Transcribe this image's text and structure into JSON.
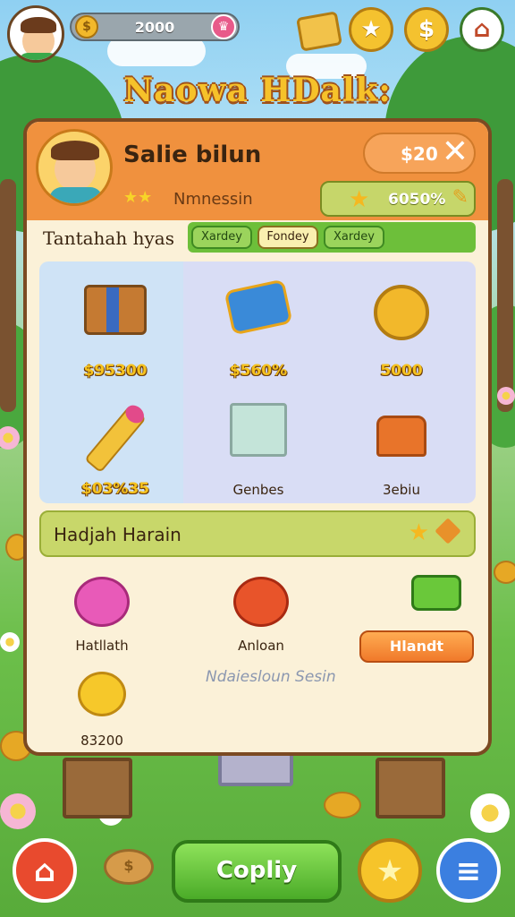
{
  "hud": {
    "coins": "2000",
    "coin_icon": "$",
    "gem_icon": "♛",
    "buttons": [
      "scroll-icon",
      "star-icon",
      "dollar-icon",
      "shop-icon"
    ]
  },
  "game_title": "Naowa HDalk:",
  "panel": {
    "player_name": "Salie bilun",
    "player_rank": "Nmnessin",
    "price": "$20",
    "close": "✕",
    "bonus": "6050%",
    "tabs_title": "Tantahah hyas",
    "tabs": [
      "Xardey",
      "Fondey",
      "Xardey"
    ],
    "grid_items": [
      {
        "label": "$95300",
        "icon": "chest-icon"
      },
      {
        "label": "$560%",
        "icon": "ticket-icon"
      },
      {
        "label": "5000",
        "icon": "gold-coin-icon"
      },
      {
        "label": "$03%35",
        "icon": "wand-icon"
      },
      {
        "label": "Genbes",
        "icon": "crystal-box-icon"
      },
      {
        "label": "3ebiu",
        "icon": "chair-icon"
      }
    ],
    "section_title": "Hadjah Harain",
    "section_items": [
      {
        "label": "Hatllath",
        "icon": "berry-icon"
      },
      {
        "label": "Anloan",
        "icon": "tomato-icon"
      },
      {
        "label": "83200",
        "icon": "sun-coin-icon"
      }
    ],
    "buy_button": "Hlandt",
    "note": "Ndaiesloun Sesin"
  },
  "bottom_nav": {
    "home": "⌂",
    "coin": "$",
    "main_button": "Copliy",
    "star": "★",
    "menu": "≡"
  },
  "colors": {
    "panel_header": "#f0913e",
    "panel_bg": "#fbf1d8",
    "green_tabs": "#6dbf3a",
    "gold_text": "#f5c21e"
  }
}
